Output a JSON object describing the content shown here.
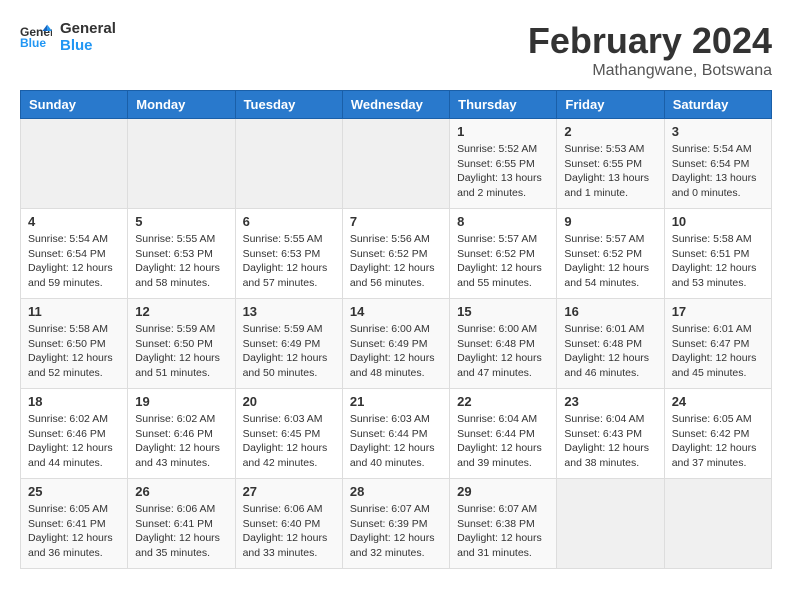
{
  "header": {
    "logo_line1": "General",
    "logo_line2": "Blue",
    "main_title": "February 2024",
    "subtitle": "Mathangwane, Botswana"
  },
  "days_of_week": [
    "Sunday",
    "Monday",
    "Tuesday",
    "Wednesday",
    "Thursday",
    "Friday",
    "Saturday"
  ],
  "weeks": [
    [
      {
        "day": "",
        "info": ""
      },
      {
        "day": "",
        "info": ""
      },
      {
        "day": "",
        "info": ""
      },
      {
        "day": "",
        "info": ""
      },
      {
        "day": "1",
        "info": "Sunrise: 5:52 AM\nSunset: 6:55 PM\nDaylight: 13 hours\nand 2 minutes."
      },
      {
        "day": "2",
        "info": "Sunrise: 5:53 AM\nSunset: 6:55 PM\nDaylight: 13 hours\nand 1 minute."
      },
      {
        "day": "3",
        "info": "Sunrise: 5:54 AM\nSunset: 6:54 PM\nDaylight: 13 hours\nand 0 minutes."
      }
    ],
    [
      {
        "day": "4",
        "info": "Sunrise: 5:54 AM\nSunset: 6:54 PM\nDaylight: 12 hours\nand 59 minutes."
      },
      {
        "day": "5",
        "info": "Sunrise: 5:55 AM\nSunset: 6:53 PM\nDaylight: 12 hours\nand 58 minutes."
      },
      {
        "day": "6",
        "info": "Sunrise: 5:55 AM\nSunset: 6:53 PM\nDaylight: 12 hours\nand 57 minutes."
      },
      {
        "day": "7",
        "info": "Sunrise: 5:56 AM\nSunset: 6:52 PM\nDaylight: 12 hours\nand 56 minutes."
      },
      {
        "day": "8",
        "info": "Sunrise: 5:57 AM\nSunset: 6:52 PM\nDaylight: 12 hours\nand 55 minutes."
      },
      {
        "day": "9",
        "info": "Sunrise: 5:57 AM\nSunset: 6:52 PM\nDaylight: 12 hours\nand 54 minutes."
      },
      {
        "day": "10",
        "info": "Sunrise: 5:58 AM\nSunset: 6:51 PM\nDaylight: 12 hours\nand 53 minutes."
      }
    ],
    [
      {
        "day": "11",
        "info": "Sunrise: 5:58 AM\nSunset: 6:50 PM\nDaylight: 12 hours\nand 52 minutes."
      },
      {
        "day": "12",
        "info": "Sunrise: 5:59 AM\nSunset: 6:50 PM\nDaylight: 12 hours\nand 51 minutes."
      },
      {
        "day": "13",
        "info": "Sunrise: 5:59 AM\nSunset: 6:49 PM\nDaylight: 12 hours\nand 50 minutes."
      },
      {
        "day": "14",
        "info": "Sunrise: 6:00 AM\nSunset: 6:49 PM\nDaylight: 12 hours\nand 48 minutes."
      },
      {
        "day": "15",
        "info": "Sunrise: 6:00 AM\nSunset: 6:48 PM\nDaylight: 12 hours\nand 47 minutes."
      },
      {
        "day": "16",
        "info": "Sunrise: 6:01 AM\nSunset: 6:48 PM\nDaylight: 12 hours\nand 46 minutes."
      },
      {
        "day": "17",
        "info": "Sunrise: 6:01 AM\nSunset: 6:47 PM\nDaylight: 12 hours\nand 45 minutes."
      }
    ],
    [
      {
        "day": "18",
        "info": "Sunrise: 6:02 AM\nSunset: 6:46 PM\nDaylight: 12 hours\nand 44 minutes."
      },
      {
        "day": "19",
        "info": "Sunrise: 6:02 AM\nSunset: 6:46 PM\nDaylight: 12 hours\nand 43 minutes."
      },
      {
        "day": "20",
        "info": "Sunrise: 6:03 AM\nSunset: 6:45 PM\nDaylight: 12 hours\nand 42 minutes."
      },
      {
        "day": "21",
        "info": "Sunrise: 6:03 AM\nSunset: 6:44 PM\nDaylight: 12 hours\nand 40 minutes."
      },
      {
        "day": "22",
        "info": "Sunrise: 6:04 AM\nSunset: 6:44 PM\nDaylight: 12 hours\nand 39 minutes."
      },
      {
        "day": "23",
        "info": "Sunrise: 6:04 AM\nSunset: 6:43 PM\nDaylight: 12 hours\nand 38 minutes."
      },
      {
        "day": "24",
        "info": "Sunrise: 6:05 AM\nSunset: 6:42 PM\nDaylight: 12 hours\nand 37 minutes."
      }
    ],
    [
      {
        "day": "25",
        "info": "Sunrise: 6:05 AM\nSunset: 6:41 PM\nDaylight: 12 hours\nand 36 minutes."
      },
      {
        "day": "26",
        "info": "Sunrise: 6:06 AM\nSunset: 6:41 PM\nDaylight: 12 hours\nand 35 minutes."
      },
      {
        "day": "27",
        "info": "Sunrise: 6:06 AM\nSunset: 6:40 PM\nDaylight: 12 hours\nand 33 minutes."
      },
      {
        "day": "28",
        "info": "Sunrise: 6:07 AM\nSunset: 6:39 PM\nDaylight: 12 hours\nand 32 minutes."
      },
      {
        "day": "29",
        "info": "Sunrise: 6:07 AM\nSunset: 6:38 PM\nDaylight: 12 hours\nand 31 minutes."
      },
      {
        "day": "",
        "info": ""
      },
      {
        "day": "",
        "info": ""
      }
    ]
  ]
}
